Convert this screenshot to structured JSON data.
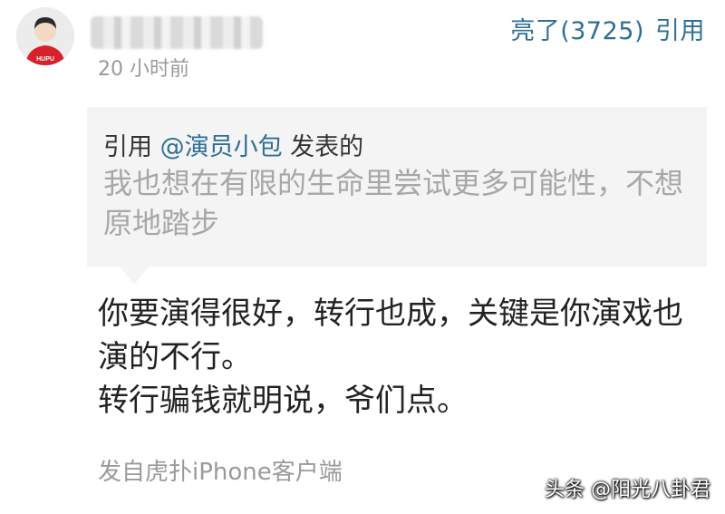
{
  "post": {
    "timestamp": "20 小时前",
    "like_label": "亮了(3725)",
    "quote_label": "引用"
  },
  "quote": {
    "prefix": "引用 ",
    "mention": "@演员小包",
    "suffix": " 发表的",
    "text": "我也想在有限的生命里尝试更多可能性，不想原地踏步"
  },
  "reply": {
    "lines": [
      "你要演得很好，转行也成，关键是你演戏也",
      "演的不行。",
      "转行骗钱就明说，爷们点。"
    ]
  },
  "footer": {
    "source": "发自虎扑iPhone客户端"
  },
  "watermark": {
    "text": "头条 @阳光八卦君"
  },
  "avatar": {
    "badge": "HUPU"
  },
  "colors": {
    "link": "#2e6f95",
    "muted": "#9a9a9a",
    "quote_bg": "#f4f4f4",
    "jersey_red": "#d6212b"
  }
}
